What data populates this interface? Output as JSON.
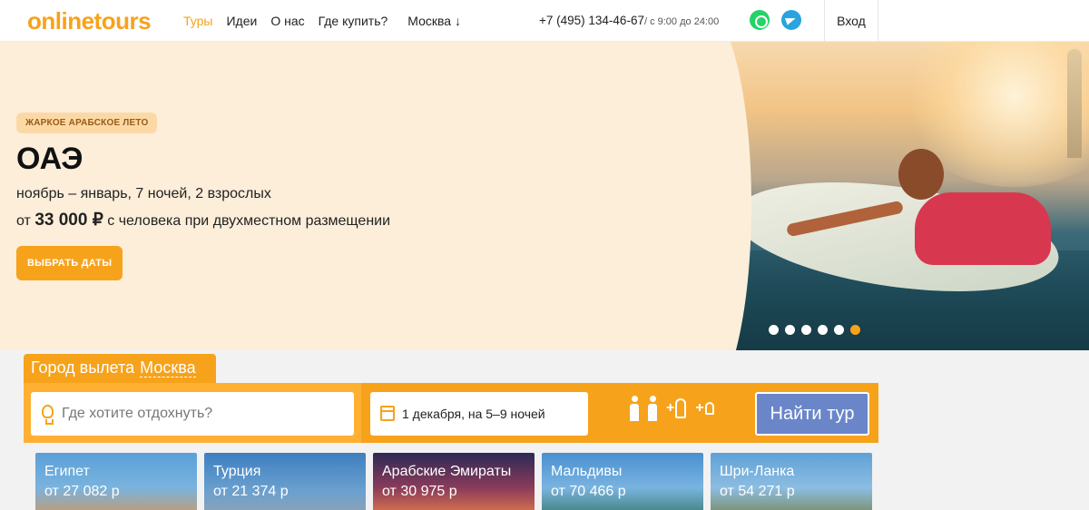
{
  "header": {
    "logo": "onlinetours",
    "nav": [
      {
        "label": "Туры",
        "active": true
      },
      {
        "label": "Идеи",
        "active": false
      },
      {
        "label": "О нас",
        "active": false
      },
      {
        "label": "Где купить?",
        "active": false
      }
    ],
    "city": "Москва ↓",
    "phone": "+7 (495) 134-46-67",
    "phone_hours": "/ с 9:00 до 24:00",
    "login": "Вход"
  },
  "hero": {
    "tag": "ЖАРКОЕ АРАБСКОЕ ЛЕТО",
    "title": "ОАЭ",
    "subtitle": "ноябрь – январь, 7 ночей, 2 взрослых",
    "price_prefix": "от",
    "price": "33 000 ₽",
    "price_suffix": "с человека при двухместном размещении",
    "button": "ВЫБРАТЬ ДАТЫ",
    "slides": 6,
    "active_slide": 6
  },
  "search": {
    "city_label": "Город вылета",
    "city_value": "Москва",
    "where_placeholder": "Где хотите отдохнуть?",
    "dates": "1 декабря, на 5–9 ночей",
    "add_adult": "+",
    "add_child": "+",
    "button": "Найти тур"
  },
  "destinations": [
    {
      "name": "Египет",
      "price": "от 27 082 р"
    },
    {
      "name": "Турция",
      "price": "от 21 374 р"
    },
    {
      "name": "Арабские Эмираты",
      "price": "от 30 975 р"
    },
    {
      "name": "Мальдивы",
      "price": "от 70 466 р"
    },
    {
      "name": "Шри-Ланка",
      "price": "от 54 271 р"
    }
  ],
  "colors": {
    "brand": "#f7a21b",
    "button_blue": "#6a86c9"
  }
}
